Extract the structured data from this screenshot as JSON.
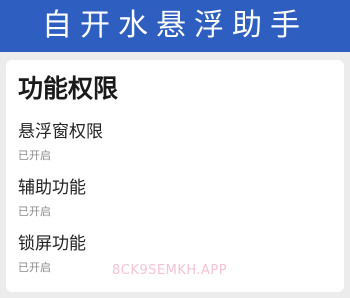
{
  "banner": {
    "title": "自开水悬浮助手"
  },
  "card": {
    "title": "功能权限",
    "items": [
      {
        "label": "悬浮窗权限",
        "status": "已开启"
      },
      {
        "label": "辅助功能",
        "status": "已开启"
      },
      {
        "label": "锁屏功能",
        "status": "已开启"
      }
    ]
  },
  "watermark": "8CK9SEMKH.APP"
}
